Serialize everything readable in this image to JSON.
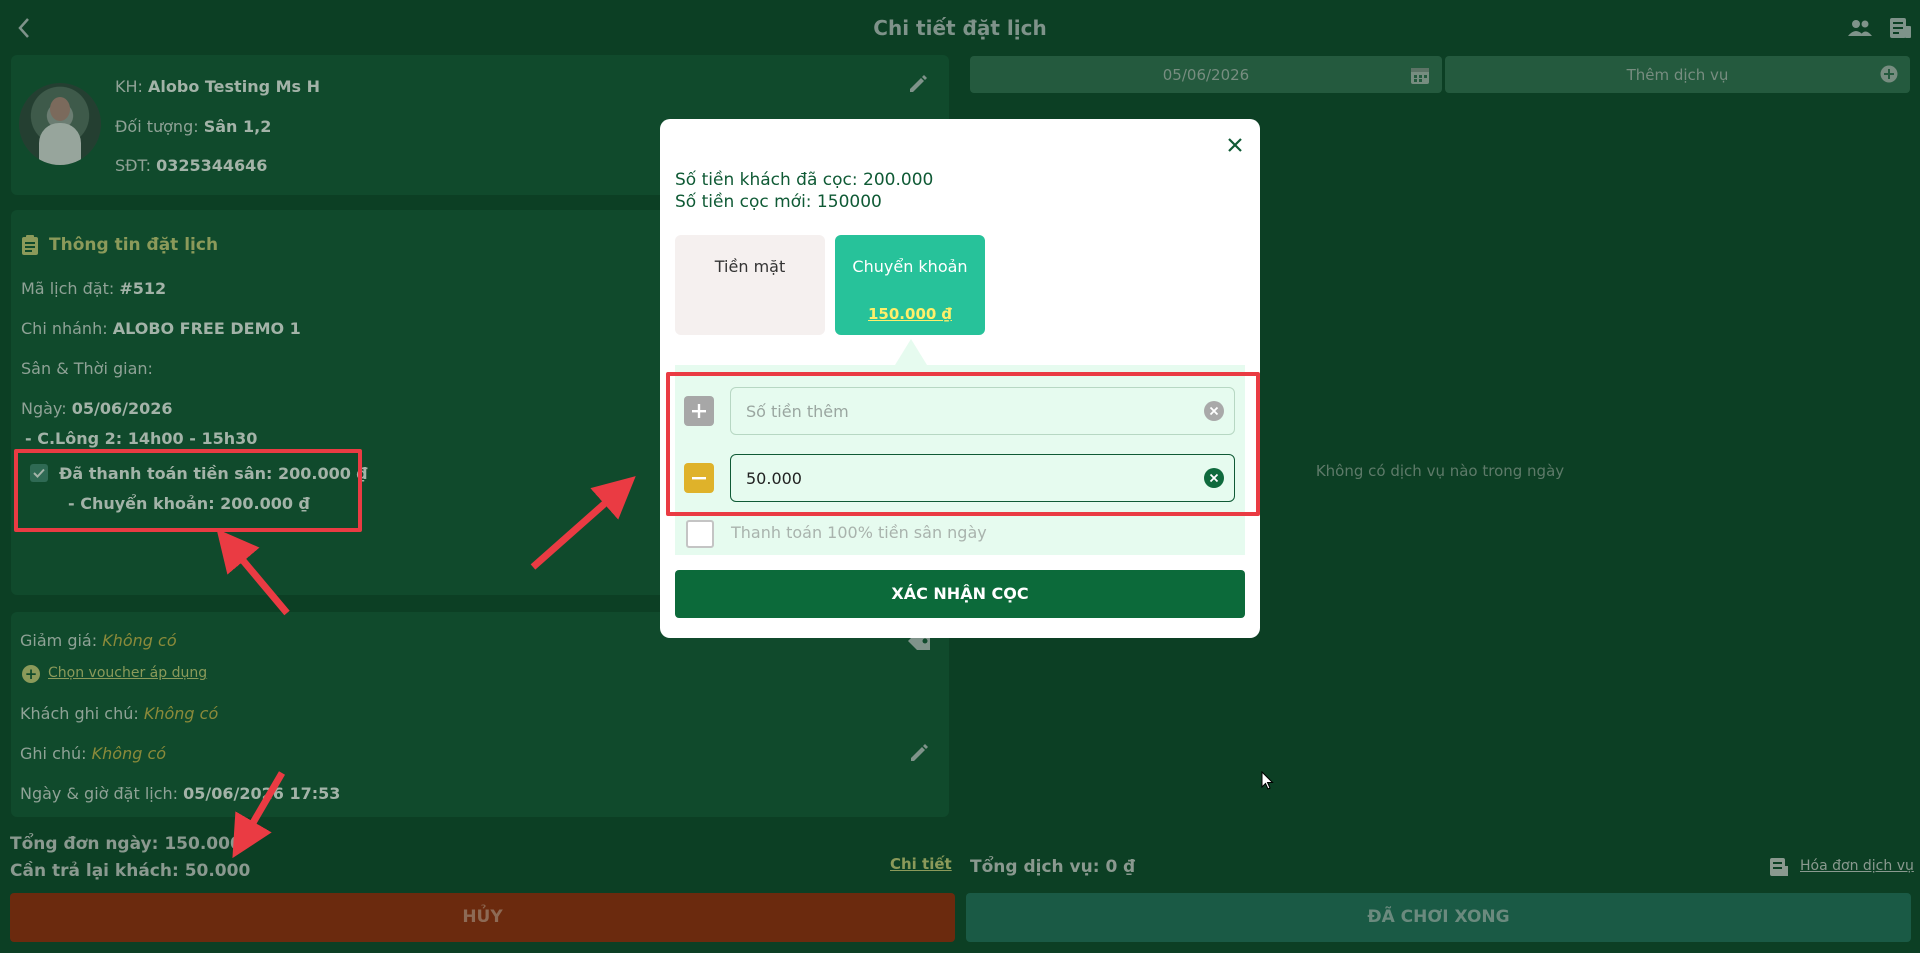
{
  "header": {
    "title": "Chi tiết đặt lịch"
  },
  "customer": {
    "name_label": "KH:",
    "name": "Alobo Testing Ms H",
    "target_label": "Đối tượng:",
    "target": "Sân 1,2",
    "phone_label": "SĐT:",
    "phone": "0325344646"
  },
  "booking": {
    "section_title": "Thông tin đặt lịch",
    "code_label": "Mã lịch đặt:",
    "code": "#512",
    "branch_label": "Chi nhánh:",
    "branch": "ALOBO FREE DEMO 1",
    "court_time_label": "Sân & Thời gian:",
    "date_label": "Ngày:",
    "date": "05/06/2026",
    "slot": "- C.Lông 2: 14h00 - 15h30",
    "paid_line": "Đã thanh toán tiền sân: 200.000 ₫",
    "paid_method": "- Chuyển khoản: 200.000 ₫"
  },
  "extras": {
    "discount_label": "Giảm giá:",
    "discount_value": "Không có",
    "voucher_link": "Chọn voucher áp dụng",
    "customer_note_label": "Khách ghi chú:",
    "customer_note_value": "Không có",
    "note_label": "Ghi chú:",
    "note_value": "Không có",
    "booked_at_label": "Ngày & giờ đặt lịch:",
    "booked_at": "05/06/2026 17:53"
  },
  "totals": {
    "day_total": "Tổng đơn ngày: 150.000",
    "refund": "Cần trả lại khách: 50.000",
    "detail_link": "Chi tiết",
    "service_total": "Tổng dịch vụ: 0 ₫",
    "invoice_link": "Hóa đơn dịch vụ"
  },
  "actions": {
    "cancel": "HỦY",
    "done": "ĐÃ CHƠI XONG"
  },
  "right_panel": {
    "date_value": "05/06/2026",
    "add_service": "Thêm dịch vụ",
    "empty_text": "Không có dịch vụ nào trong ngày"
  },
  "modal": {
    "deposited": "Số tiền khách đã cọc: 200.000",
    "new_deposit": "Số tiền cọc mới: 150000",
    "cash_label": "Tiền mặt",
    "transfer_label": "Chuyển khoản",
    "transfer_amount": "150.000 ₫",
    "add_placeholder": "Số tiền thêm",
    "subtract_value": "50.000",
    "full_payment_label": "Thanh toán 100% tiền sân ngày",
    "confirm": "XÁC NHẬN CỌC"
  },
  "colors": {
    "background": "#0c3f24",
    "card": "#104a2c",
    "accent_green": "#27c29a",
    "confirm_green": "#0c6a3a",
    "cancel_red": "#6b2a0e",
    "annotation_red": "#ea3b43",
    "stepper_yellow": "#dfb22a"
  }
}
